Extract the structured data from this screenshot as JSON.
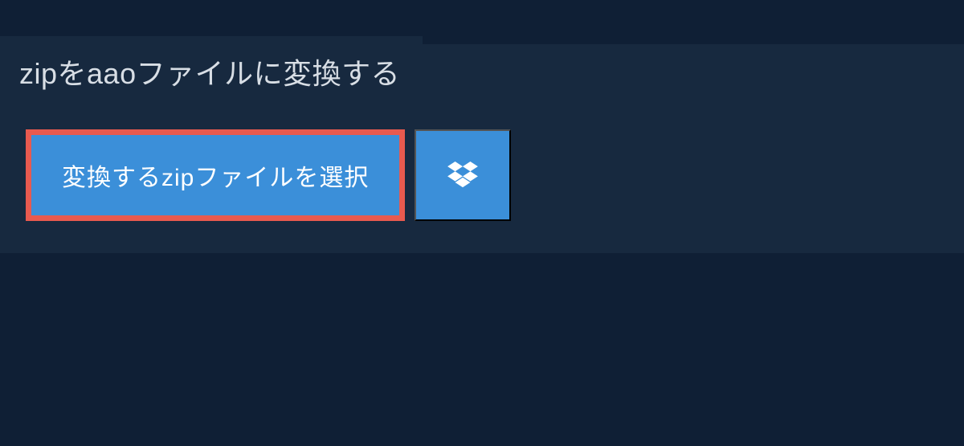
{
  "heading": "zipをaaoファイルに変換する",
  "buttons": {
    "select_file_label": "変換するzipファイルを選択"
  },
  "colors": {
    "page_bg": "#0f1f35",
    "panel_bg": "#17293f",
    "button_bg": "#3b8fd9",
    "button_border": "#e85a4f",
    "text_light": "#d8dee5",
    "text_white": "#ffffff"
  }
}
